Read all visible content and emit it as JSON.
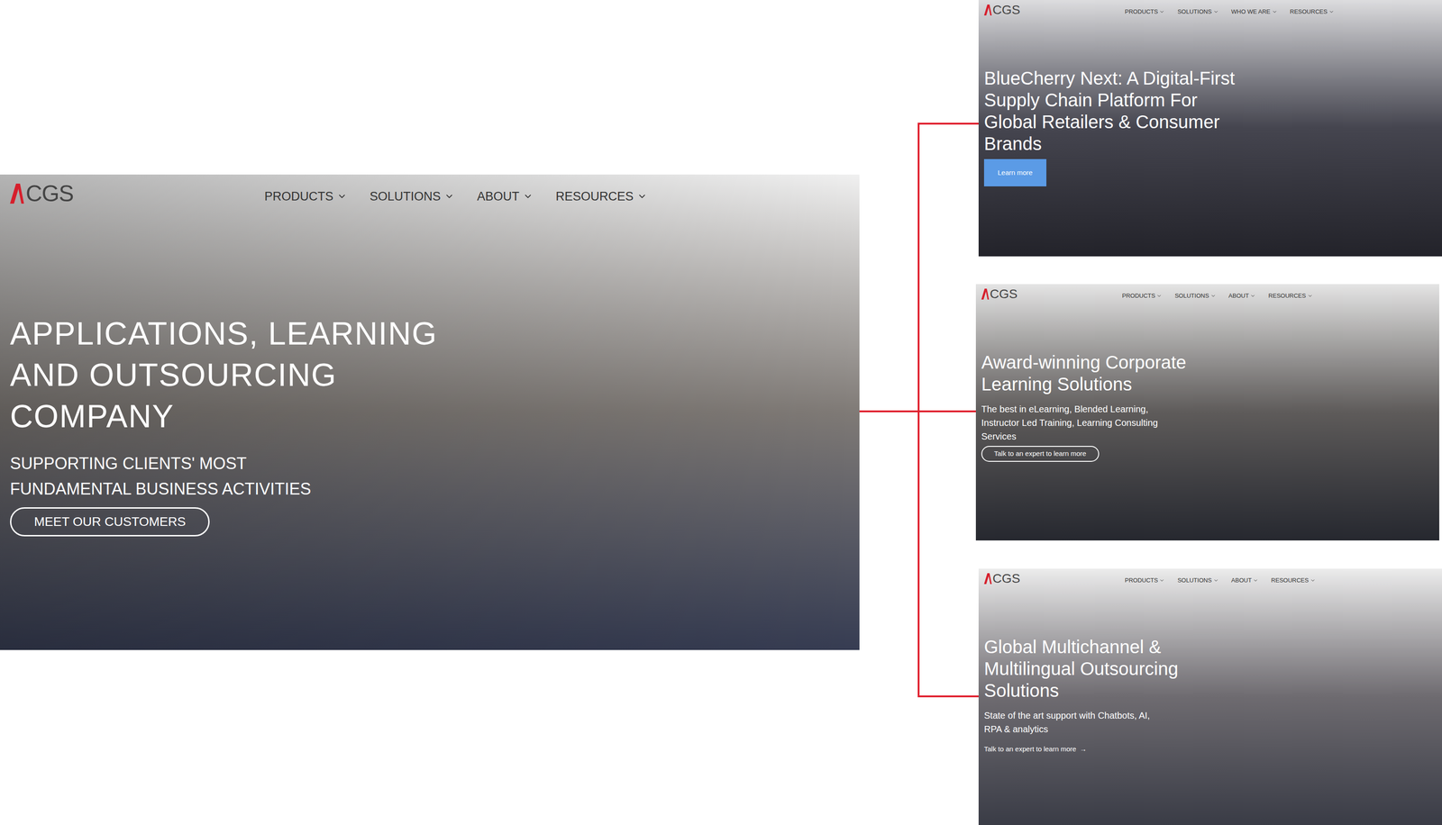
{
  "main": {
    "logo": "CGS",
    "nav": [
      "PRODUCTS",
      "SOLUTIONS",
      "ABOUT",
      "RESOURCES"
    ],
    "headline": "APPLICATIONS, LEARNING AND OUTSOURCING COMPANY",
    "subheadline": "SUPPORTING CLIENTS' MOST FUNDAMENTAL BUSINESS ACTIVITIES",
    "button": "MEET OUR CUSTOMERS"
  },
  "variants": [
    {
      "logo": "CGS",
      "nav": [
        "PRODUCTS",
        "SOLUTIONS",
        "WHO WE ARE",
        "RESOURCES"
      ],
      "headline": "BlueCherry Next: A Digital-First Supply Chain Platform For Global Retailers & Consumer Brands",
      "cta": "Learn more",
      "kind": "filled"
    },
    {
      "logo": "CGS",
      "nav": [
        "PRODUCTS",
        "SOLUTIONS",
        "ABOUT",
        "RESOURCES"
      ],
      "headline": "Award-winning Corporate Learning Solutions",
      "description": "The best in eLearning, Blended Learning, Instructor Led Training, Learning Consulting Services",
      "cta": "Talk to an expert to learn more",
      "kind": "outline"
    },
    {
      "logo": "CGS",
      "nav": [
        "PRODUCTS",
        "SOLUTIONS",
        "ABOUT",
        "RESOURCES"
      ],
      "headline": "Global Multichannel & Multilingual Outsourcing Solutions",
      "description": "State of the art support with Chatbots, AI, RPA & analytics",
      "cta": "Talk to an expert to learn more",
      "arrow": "→",
      "kind": "link"
    }
  ]
}
